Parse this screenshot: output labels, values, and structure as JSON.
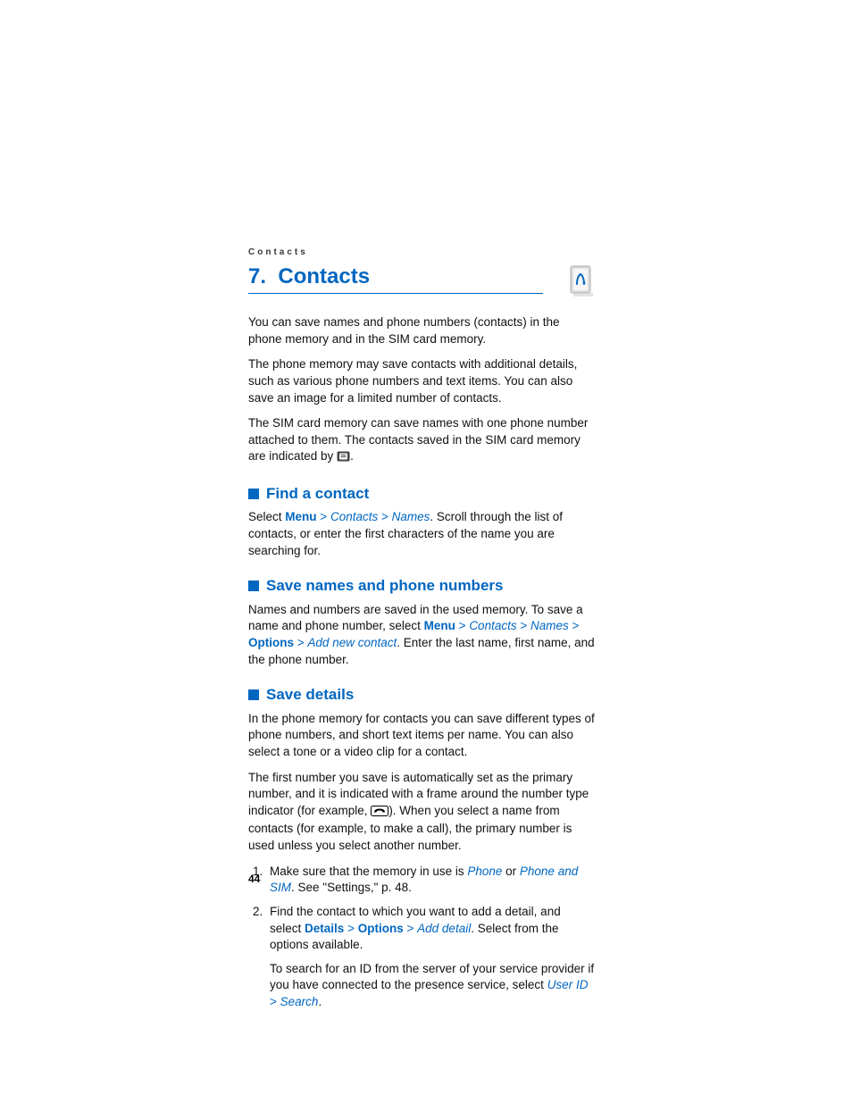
{
  "running_head": "Contacts",
  "chapter": {
    "number": "7.",
    "title": "Contacts"
  },
  "intro": {
    "p1": "You can save names and phone numbers (contacts) in the phone memory and in the SIM card memory.",
    "p2": "The phone memory may save contacts with additional details, such as various phone numbers and text items. You can also save an image for a limited number of contacts.",
    "p3a": "The SIM card memory can save names with one phone number attached to them. The contacts saved in the SIM card memory are indicated by ",
    "p3b": "."
  },
  "sections": {
    "find": {
      "title": "Find a contact",
      "pre": "Select ",
      "menu": "Menu",
      "contacts": "Contacts",
      "names": "Names",
      "post": ". Scroll through the list of contacts, or enter the first characters of the name you are searching for."
    },
    "save_names": {
      "title": "Save names and phone numbers",
      "pre": "Names and numbers are saved in the used memory. To save a name and phone number, select ",
      "menu": "Menu",
      "contacts": "Contacts",
      "names": "Names",
      "options": "Options",
      "addnew": "Add new contact",
      "post": ". Enter the last name, first name, and the phone number."
    },
    "save_details": {
      "title": "Save details",
      "p1": "In the phone memory for contacts you can save different types of phone numbers, and short text items per name. You can also select a tone or a video clip for a contact.",
      "p2a": "The first number you save is automatically set as the primary number, and it is indicated with a frame around the number type indicator (for example, ",
      "p2b": "). When you select a name from contacts (for example, to make a call), the primary number is used unless you select another number.",
      "li1_pre": "Make sure that the memory in use is ",
      "li1_phone": "Phone",
      "li1_or": " or ",
      "li1_phonesim": "Phone and SIM",
      "li1_post": ". See \"Settings,\" p. 48.",
      "li2_pre": "Find the contact to which you want to add a detail, and select ",
      "li2_details": "Details",
      "li2_options": "Options",
      "li2_add": "Add detail",
      "li2_post": ". Select from the options available.",
      "li2_sub_pre": "To search for an ID from the server of your service provider if you have connected to the presence service, select ",
      "li2_userid": "User ID",
      "li2_search": "Search",
      "li2_sub_post": "."
    }
  },
  "gt": ">",
  "page_number": "44"
}
